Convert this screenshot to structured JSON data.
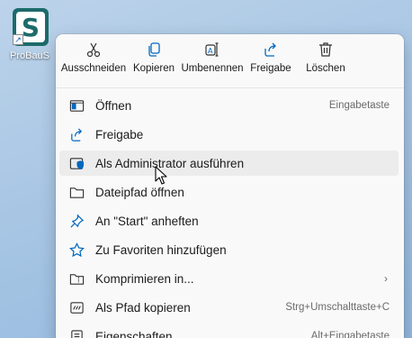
{
  "desktop": {
    "icon_label": "ProBauS",
    "icon_letter": "S"
  },
  "toolbar": [
    {
      "label": "Ausschneiden",
      "icon": "scissors-icon"
    },
    {
      "label": "Kopieren",
      "icon": "copy-icon"
    },
    {
      "label": "Umbenennen",
      "icon": "rename-icon"
    },
    {
      "label": "Freigabe",
      "icon": "share-icon"
    },
    {
      "label": "Löschen",
      "icon": "trash-icon"
    }
  ],
  "items": [
    {
      "label": "Öffnen",
      "shortcut": "Eingabetaste",
      "icon": "app-window-icon"
    },
    {
      "label": "Freigabe",
      "shortcut": "",
      "icon": "share-icon"
    },
    {
      "label": "Als Administrator ausführen",
      "shortcut": "",
      "icon": "admin-shield-icon"
    },
    {
      "label": "Dateipfad öffnen",
      "shortcut": "",
      "icon": "folder-icon"
    },
    {
      "label": "An \"Start\" anheften",
      "shortcut": "",
      "icon": "pin-icon"
    },
    {
      "label": "Zu Favoriten hinzufügen",
      "shortcut": "",
      "icon": "star-icon"
    },
    {
      "label": "Komprimieren in...",
      "shortcut": "",
      "icon": "zip-folder-icon",
      "submenu": true
    },
    {
      "label": "Als Pfad kopieren",
      "shortcut": "Strg+Umschalttaste+C",
      "icon": "copy-path-icon"
    },
    {
      "label": "Eigenschaften",
      "shortcut": "Alt+Eingabetaste",
      "icon": "properties-icon"
    }
  ],
  "colors": {
    "accent": "#0067c0",
    "menu_bg": "#f9f9f9",
    "hover_bg": "#ececec"
  }
}
